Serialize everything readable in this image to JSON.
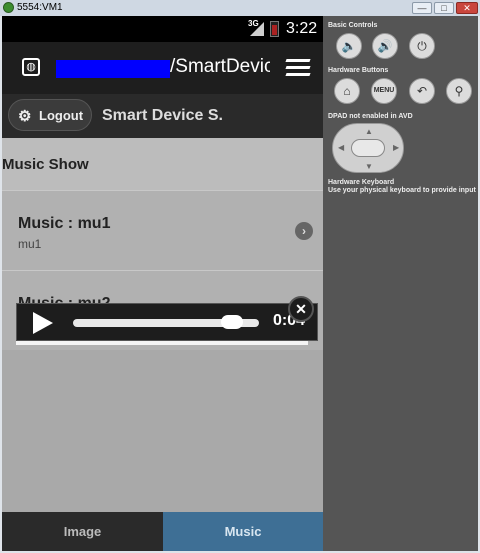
{
  "window": {
    "title": "5554:VM1",
    "minimize": "—",
    "maximize": "□",
    "close": "✕"
  },
  "status_bar": {
    "network": "3G",
    "time": "3:22"
  },
  "top_bar": {
    "url_suffix": "/SmartDevic"
  },
  "header": {
    "logout_label": "Logout",
    "page_title": "Smart Device S..."
  },
  "content": {
    "section_title": "Music Show",
    "items": [
      {
        "title": "Music : mu1",
        "subtitle": "mu1"
      },
      {
        "title": "Music : mu2",
        "subtitle": ""
      }
    ]
  },
  "player": {
    "time": "0:04",
    "progress": 0.9
  },
  "tabs": [
    {
      "label": "Image",
      "active": false
    },
    {
      "label": "Music",
      "active": true
    }
  ],
  "controls": {
    "basic_label": "Basic Controls",
    "hardware_label": "Hardware Buttons",
    "menu_label": "MENU",
    "dpad_label": "DPAD not enabled in AVD",
    "keyboard_label": "Hardware Keyboard",
    "keyboard_note": "Use your physical keyboard to provide input"
  },
  "colors": {
    "url_highlight": "#0000ff",
    "active_tab": "#3e6f95"
  }
}
